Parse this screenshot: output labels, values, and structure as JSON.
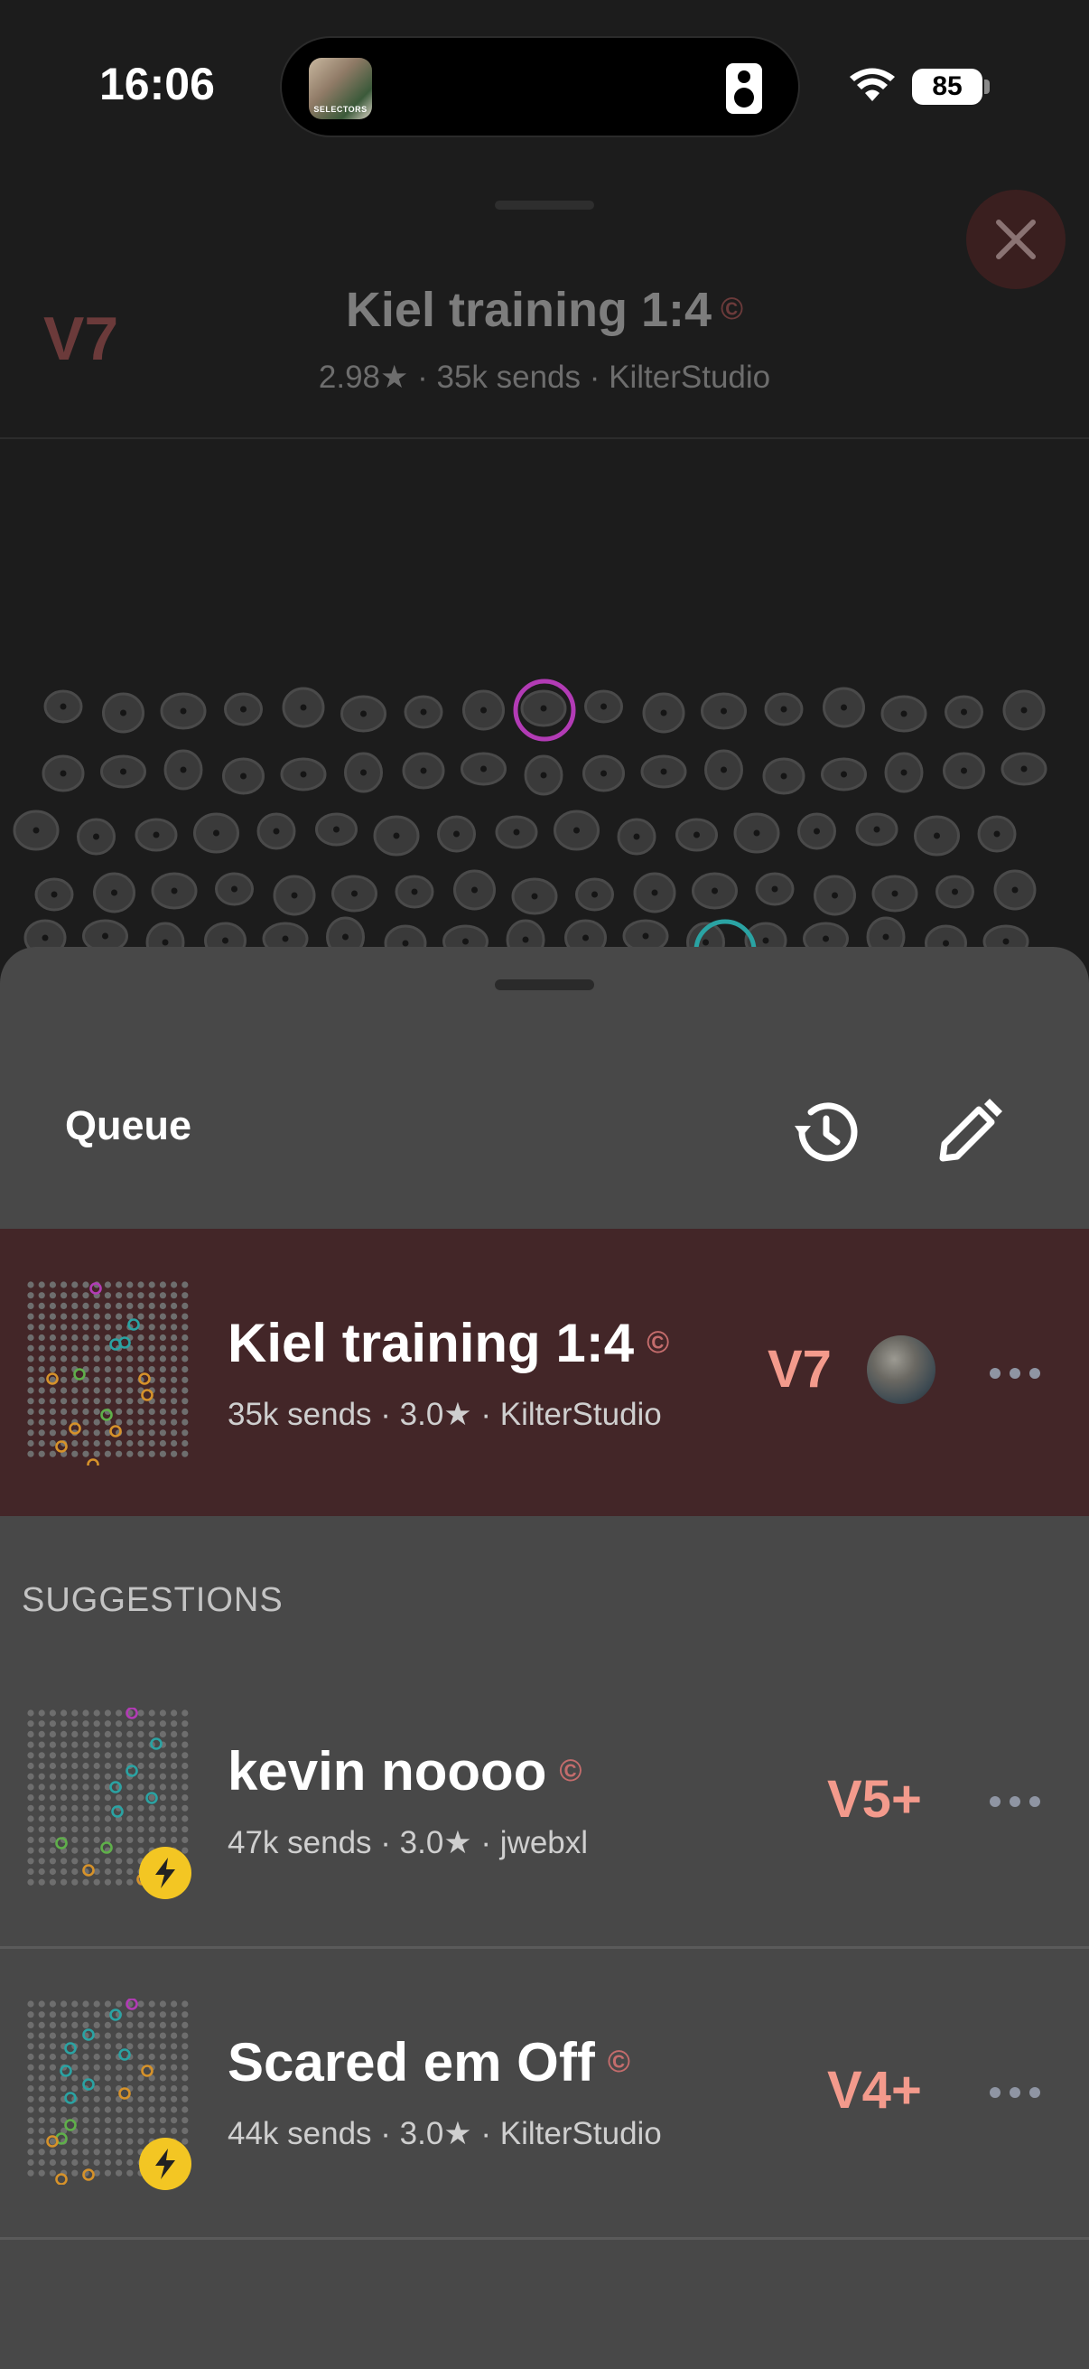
{
  "status_bar": {
    "time": "16:06",
    "battery": "85",
    "island_art_text": "SELECTORS"
  },
  "background": {
    "grade": "V7",
    "title": "Kiel training 1:4",
    "copyright_mark": "©",
    "subtitle": "2.98★ · 35k sends · KilterStudio"
  },
  "sheet": {
    "title": "Queue",
    "history_icon": "history-icon",
    "edit_icon": "pencil-icon",
    "current": {
      "title": "Kiel training 1:4",
      "copyright_mark": "©",
      "subtitle": "35k sends · 3.0★ · KilterStudio",
      "grade": "V7"
    },
    "suggestions_header": "SUGGESTIONS",
    "suggestions": [
      {
        "title": "kevin noooo",
        "copyright_mark": "©",
        "subtitle": "47k sends · 3.0★ · jwebxl",
        "grade": "V5+"
      },
      {
        "title": "Scared em Off",
        "copyright_mark": "©",
        "subtitle": "44k sends · 3.0★ · KilterStudio",
        "grade": "V4+"
      }
    ]
  },
  "colors": {
    "current_row_bg": "#432628",
    "grade": "#f39a8c",
    "sheet_bg": "#484848",
    "bolt_badge": "#f3c623",
    "hold_start": "#2aa3a3",
    "hold_finish": "#b23bb5"
  }
}
